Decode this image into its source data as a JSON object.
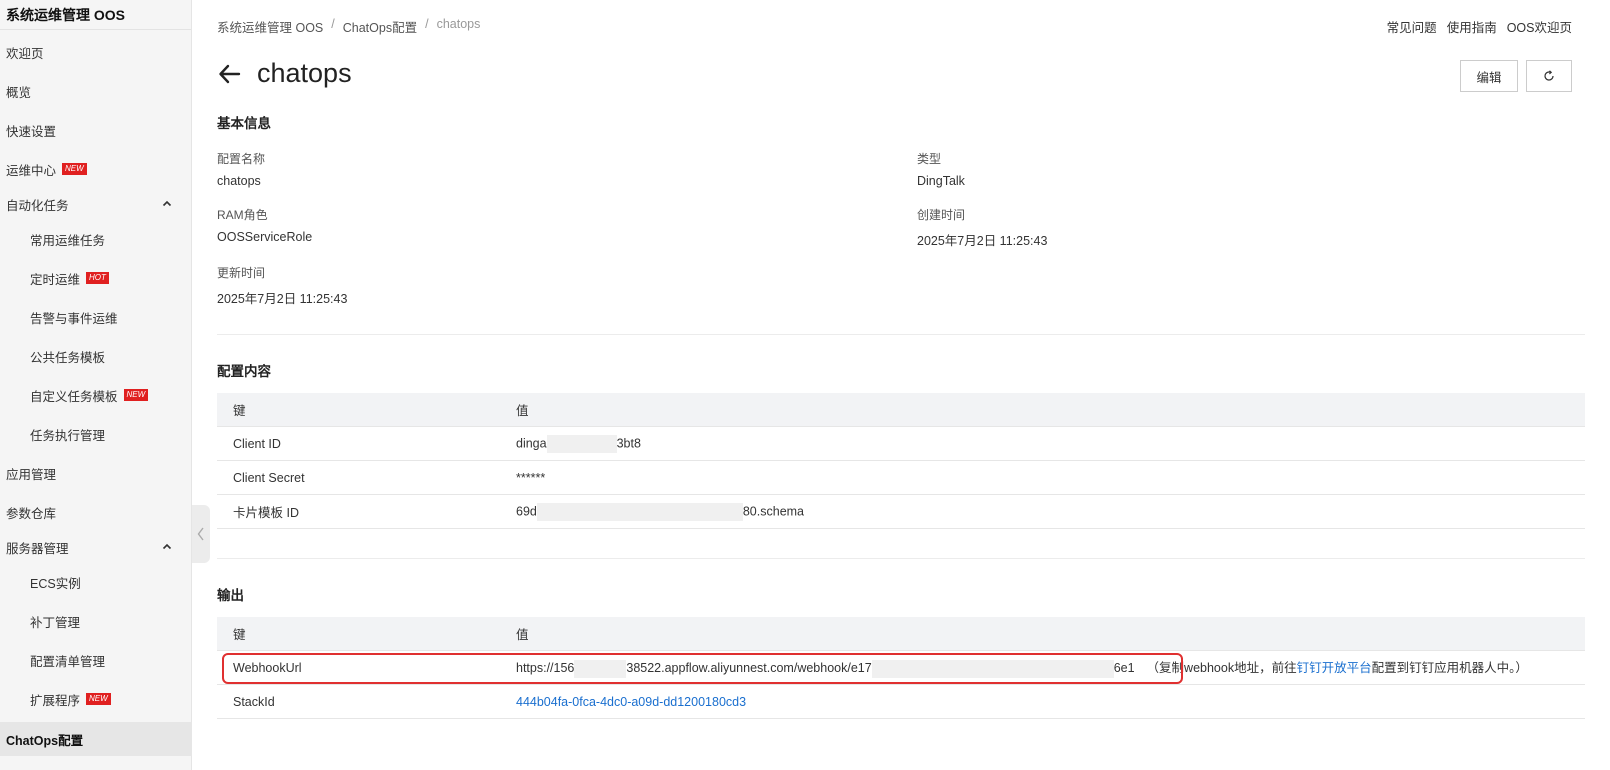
{
  "sidebar": {
    "title": "系统运维管理 OOS",
    "items": [
      {
        "label": "欢迎页"
      },
      {
        "label": "概览"
      },
      {
        "label": "快速设置"
      },
      {
        "label": "运维中心",
        "badge": "NEW"
      },
      {
        "label": "自动化任务"
      },
      {
        "label": "常用运维任务"
      },
      {
        "label": "定时运维",
        "badge": "HOT"
      },
      {
        "label": "告警与事件运维"
      },
      {
        "label": "公共任务模板"
      },
      {
        "label": "自定义任务模板",
        "badge": "NEW"
      },
      {
        "label": "任务执行管理"
      },
      {
        "label": "应用管理"
      },
      {
        "label": "参数仓库"
      },
      {
        "label": "服务器管理"
      },
      {
        "label": "ECS实例"
      },
      {
        "label": "补丁管理"
      },
      {
        "label": "配置清单管理"
      },
      {
        "label": "扩展程序",
        "badge": "NEW"
      },
      {
        "label": "ChatOps配置"
      }
    ]
  },
  "breadcrumb": [
    "系统运维管理 OOS",
    "ChatOps配置",
    "chatops"
  ],
  "breadcrumb_sep": "/",
  "toplinks": [
    "常见问题",
    "使用指南",
    "OOS欢迎页"
  ],
  "page": {
    "title": "chatops",
    "edit_label": "编辑"
  },
  "basic_info": {
    "title": "基本信息",
    "config_name_label": "配置名称",
    "config_name": "chatops",
    "type_label": "类型",
    "type": "DingTalk",
    "ram_role_label": "RAM角色",
    "ram_role": "OOSServiceRole",
    "created_label": "创建时间",
    "created": "2025年7月2日 11:25:43",
    "updated_label": "更新时间",
    "updated": "2025年7月2日 11:25:43"
  },
  "config_content": {
    "title": "配置内容",
    "col_key": "键",
    "col_value": "值",
    "rows": [
      {
        "key": "Client ID",
        "v_prefix": "dinga",
        "v_suffix": "3bt8"
      },
      {
        "key": "Client Secret",
        "value": "******"
      },
      {
        "key": "卡片模板 ID",
        "v_prefix": "69d",
        "v_suffix": "80.schema"
      }
    ]
  },
  "output": {
    "title": "输出",
    "col_key": "键",
    "col_value": "值",
    "webhook_key": "WebhookUrl",
    "webhook_prefix": "https://156",
    "webhook_middle": "38522.appflow.aliyunnest.com/webhook/e17",
    "webhook_suffix": "6e1",
    "hint_before": "（复制webhook地址，前往",
    "hint_link": "钉钉开放平台",
    "hint_after": "配置到钉钉应用机器人中。）",
    "stack_key": "StackId",
    "stack_value": "444b04fa-0fca-4dc0-a09d-dd1200180cd3"
  }
}
